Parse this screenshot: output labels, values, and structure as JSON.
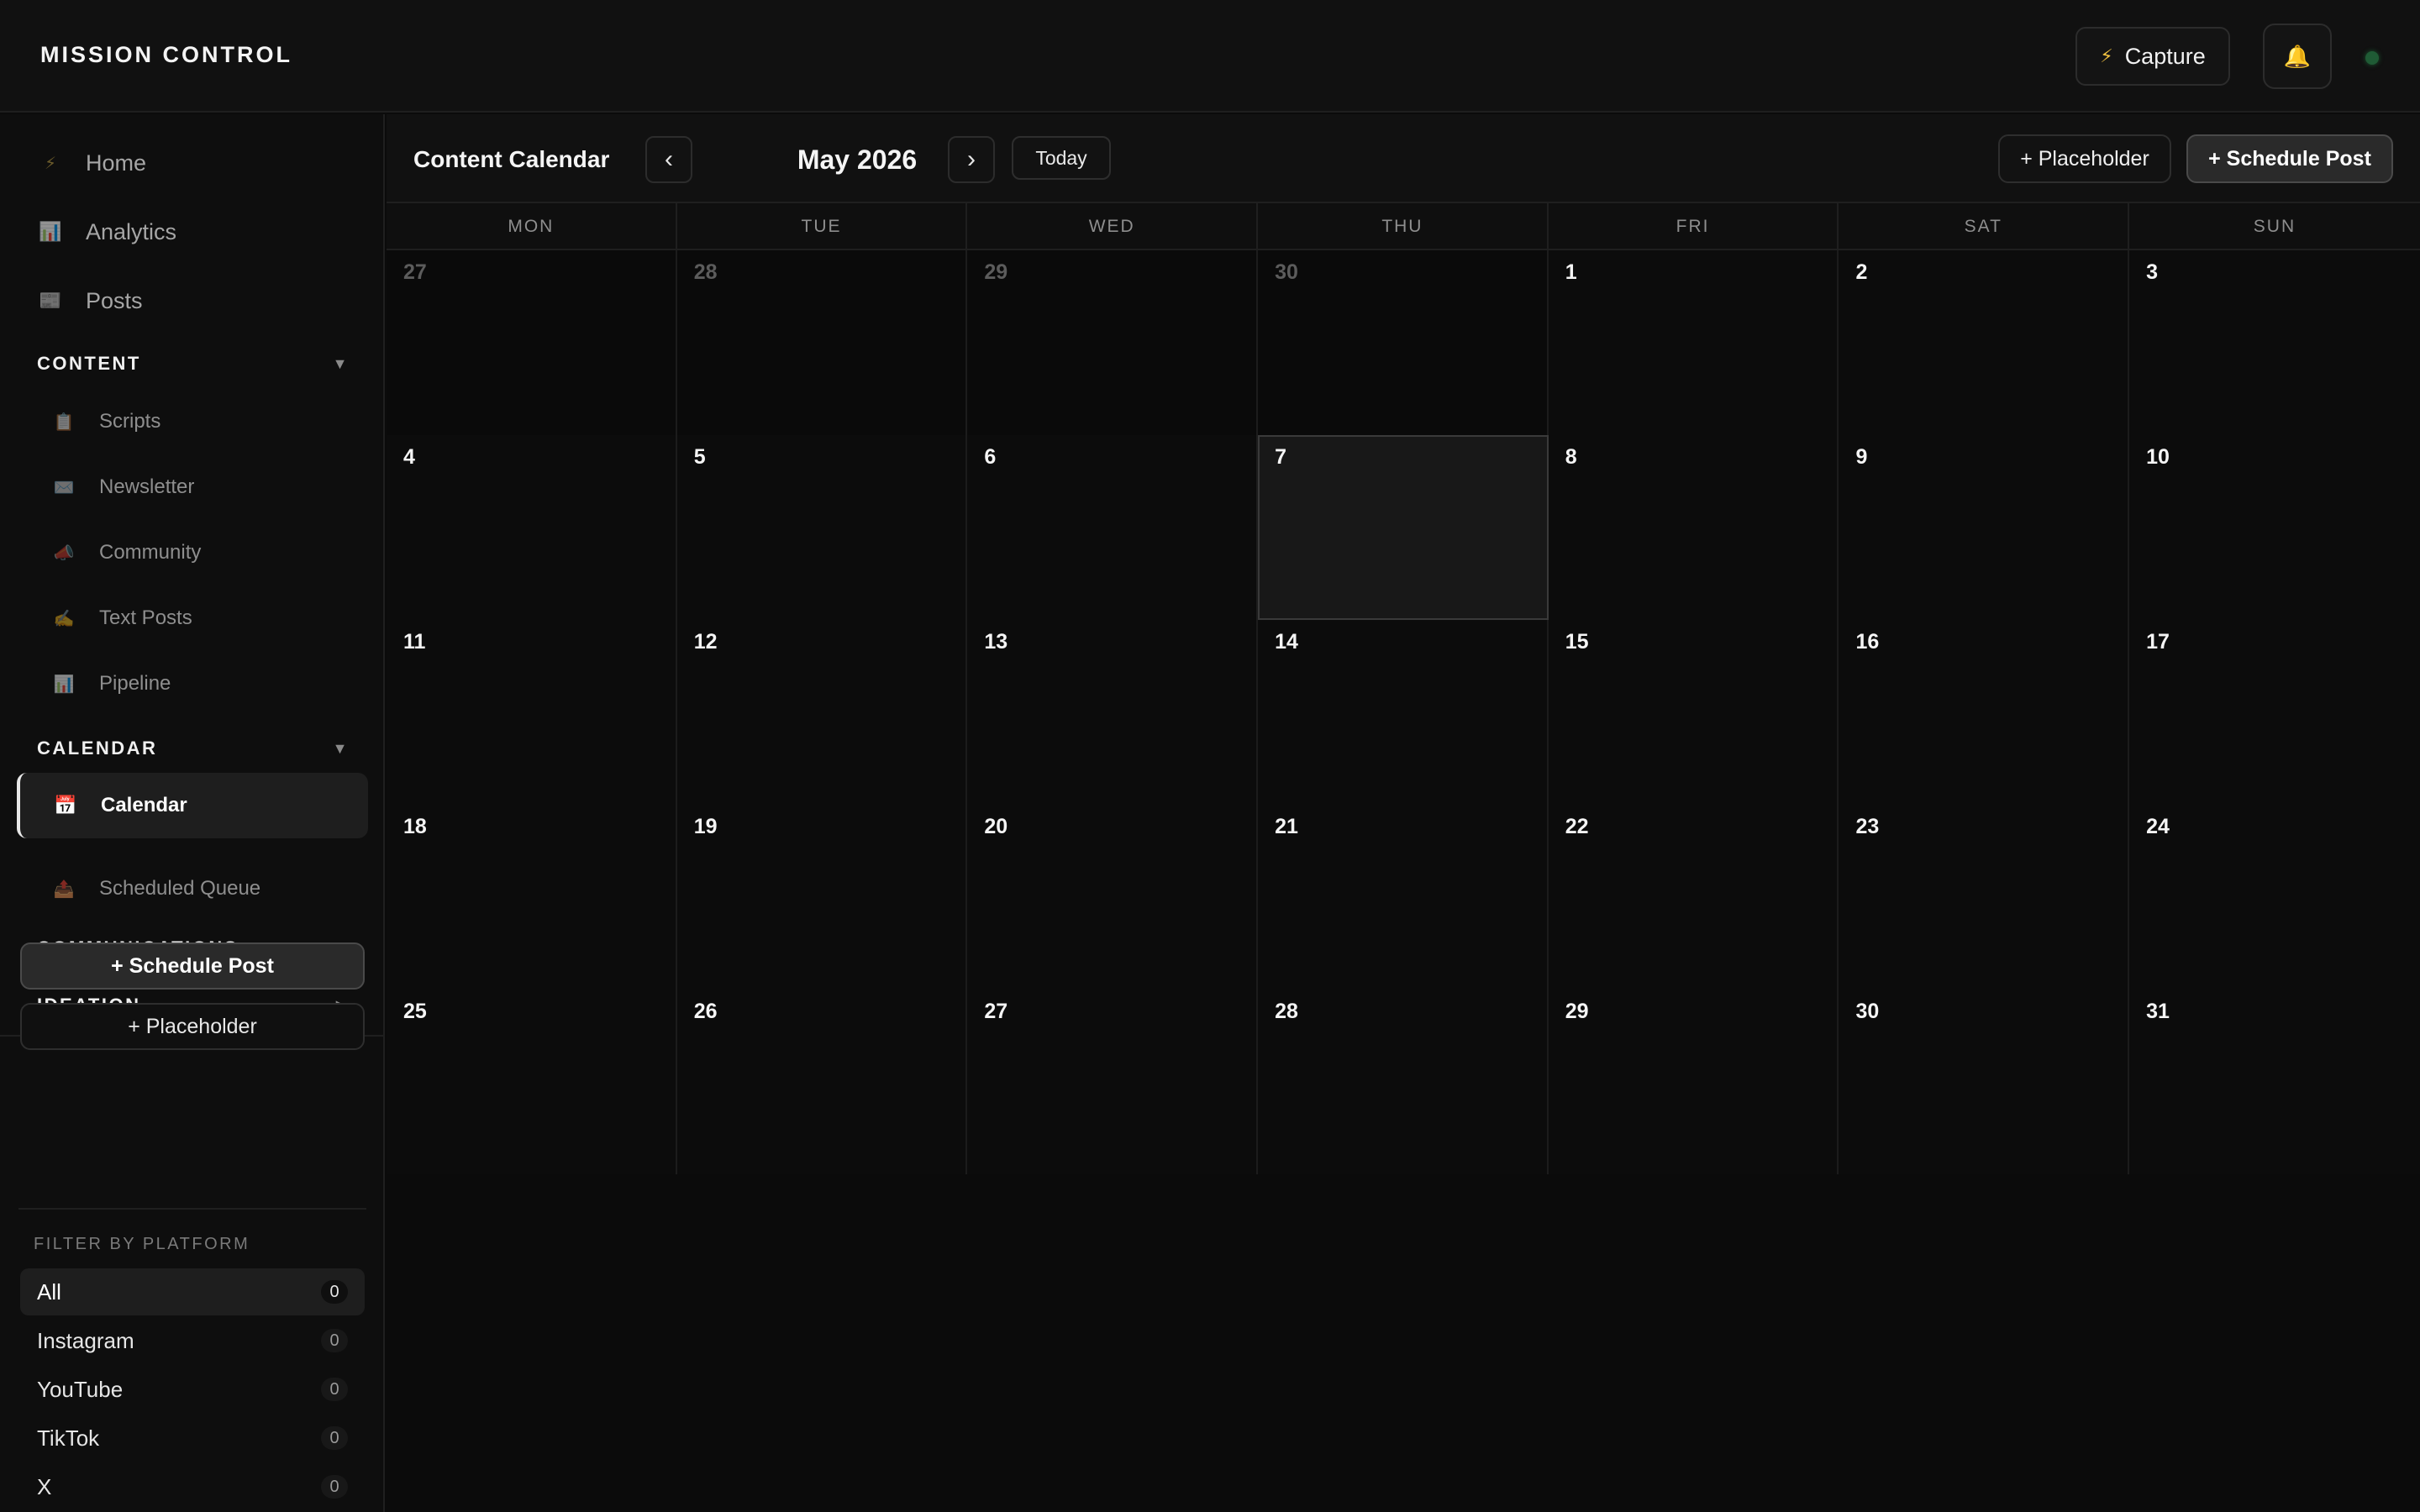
{
  "app": {
    "title": "MISSION CONTROL",
    "capture_label": "Capture",
    "capture_icon": "⚡",
    "bell_icon": "🔔",
    "status_color": "#1f5b35"
  },
  "sidebar": {
    "top_items": [
      {
        "label": "Home",
        "icon": "⚡"
      },
      {
        "label": "Analytics",
        "icon": "📊"
      },
      {
        "label": "Posts",
        "icon": "📰"
      }
    ],
    "sections": {
      "content": {
        "title": "CONTENT",
        "caret": "▼",
        "items": [
          {
            "label": "Scripts",
            "icon": "📋"
          },
          {
            "label": "Newsletter",
            "icon": "✉️"
          },
          {
            "label": "Community",
            "icon": "📣"
          },
          {
            "label": "Text Posts",
            "icon": "✍️"
          },
          {
            "label": "Pipeline",
            "icon": "📊"
          }
        ]
      },
      "calendar": {
        "title": "CALENDAR",
        "caret": "▼",
        "items": [
          {
            "label": "Calendar",
            "icon": "📅"
          },
          {
            "label": "Scheduled Queue",
            "icon": "📤"
          }
        ]
      },
      "communications": {
        "title": "COMMUNICATIONS",
        "caret": "▶"
      },
      "ideation": {
        "title": "IDEATION",
        "caret": "▶"
      }
    },
    "schedule_post_label": "+ Schedule Post",
    "placeholder_label": "+ Placeholder",
    "filter": {
      "title": "FILTER BY PLATFORM",
      "items": [
        {
          "label": "All",
          "count": "0"
        },
        {
          "label": "Instagram",
          "count": "0"
        },
        {
          "label": "YouTube",
          "count": "0"
        },
        {
          "label": "TikTok",
          "count": "0"
        },
        {
          "label": "X",
          "count": "0"
        }
      ]
    }
  },
  "main": {
    "title": "Content Calendar",
    "prev_icon": "‹",
    "next_icon": "›",
    "month": "May 2026",
    "today_label": "Today",
    "placeholder_label": "+ Placeholder",
    "schedule_post_label": "+ Schedule Post"
  },
  "calendar": {
    "weekdays": [
      "MON",
      "TUE",
      "WED",
      "THU",
      "FRI",
      "SAT",
      "SUN"
    ],
    "weeks": [
      [
        {
          "day": "27",
          "other": true
        },
        {
          "day": "28",
          "other": true
        },
        {
          "day": "29",
          "other": true
        },
        {
          "day": "30",
          "other": true
        },
        {
          "day": "1"
        },
        {
          "day": "2"
        },
        {
          "day": "3"
        }
      ],
      [
        {
          "day": "4"
        },
        {
          "day": "5"
        },
        {
          "day": "6"
        },
        {
          "day": "7",
          "today": true
        },
        {
          "day": "8"
        },
        {
          "day": "9"
        },
        {
          "day": "10"
        }
      ],
      [
        {
          "day": "11"
        },
        {
          "day": "12"
        },
        {
          "day": "13"
        },
        {
          "day": "14"
        },
        {
          "day": "15"
        },
        {
          "day": "16"
        },
        {
          "day": "17"
        }
      ],
      [
        {
          "day": "18"
        },
        {
          "day": "19"
        },
        {
          "day": "20"
        },
        {
          "day": "21"
        },
        {
          "day": "22"
        },
        {
          "day": "23"
        },
        {
          "day": "24"
        }
      ],
      [
        {
          "day": "25"
        },
        {
          "day": "26"
        },
        {
          "day": "27"
        },
        {
          "day": "28"
        },
        {
          "day": "29"
        },
        {
          "day": "30"
        },
        {
          "day": "31"
        }
      ]
    ]
  }
}
